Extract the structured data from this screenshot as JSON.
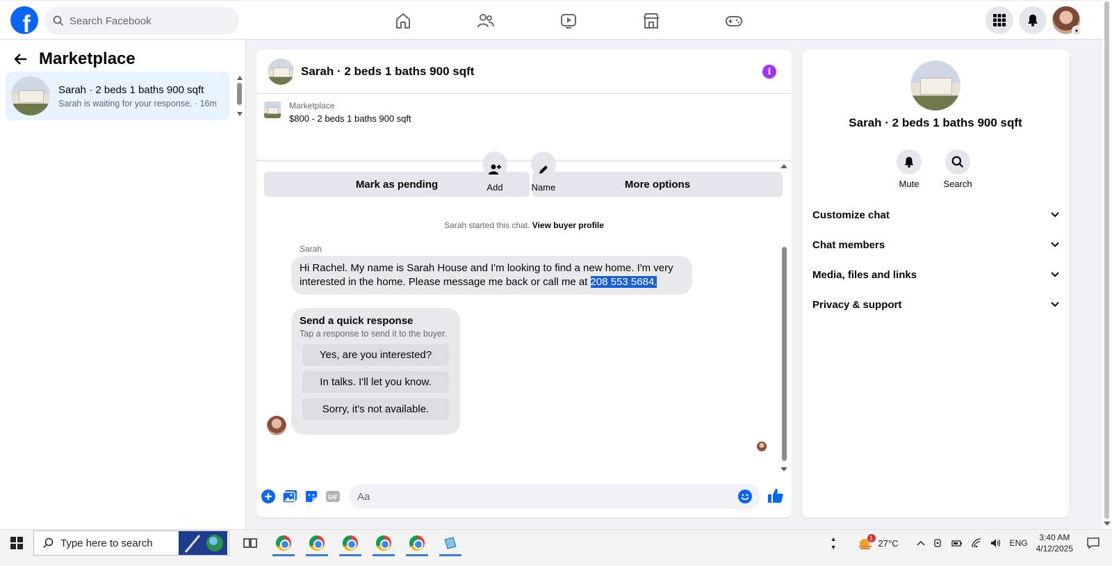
{
  "topbar": {
    "logo": "f",
    "search_placeholder": "Search Facebook",
    "nav_icons": [
      "home-icon",
      "friends-icon",
      "watch-icon",
      "marketplace-icon",
      "gaming-icon"
    ],
    "right_icons": [
      "apps-grid-icon",
      "notifications-bell-icon",
      "profile-avatar"
    ]
  },
  "sidebar": {
    "title": "Marketplace",
    "conversation": {
      "title": "Sarah · 2 beds 1 baths 900 sqft",
      "subtitle": "Sarah is waiting for your response. · 16m"
    }
  },
  "chat": {
    "header_title": "Sarah · 2 beds 1 baths 900 sqft",
    "listing": {
      "label": "Marketplace",
      "price_title": "$800 - 2 beds 1 baths 900 sqft",
      "mark_pending": "Mark as pending",
      "more_options": "More options"
    },
    "actions": {
      "add": "Add",
      "name": "Name"
    },
    "started_text": "Sarah started this chat.",
    "view_buyer_profile": "View buyer profile",
    "sender": "Sarah",
    "message_text": "Hi Rachel. My name is Sarah House and I'm looking to find a new home. I'm very interested in the home. Please message me back or call me at ",
    "message_phone": "208 553 5684.",
    "quick_response": {
      "title": "Send a quick response",
      "subtitle": "Tap a response to send it to the buyer.",
      "options": [
        "Yes, are you interested?",
        "In talks. I'll let you know.",
        "Sorry, it's not available."
      ]
    },
    "composer_placeholder": "Aa"
  },
  "info_panel": {
    "title": "Sarah · 2 beds 1 baths 900 sqft",
    "mute": "Mute",
    "search": "Search",
    "sections": [
      "Customize chat",
      "Chat members",
      "Media, files and links",
      "Privacy & support"
    ]
  },
  "taskbar": {
    "search_placeholder": "Type here to search",
    "weather_badge": "1",
    "temperature": "27°C",
    "language": "ENG",
    "time": "3:40 AM",
    "date": "4/12/2025"
  },
  "colors": {
    "facebook_blue": "#0866ff",
    "info_purple": "#a033ff",
    "selection_blue": "#1a5fd6"
  }
}
